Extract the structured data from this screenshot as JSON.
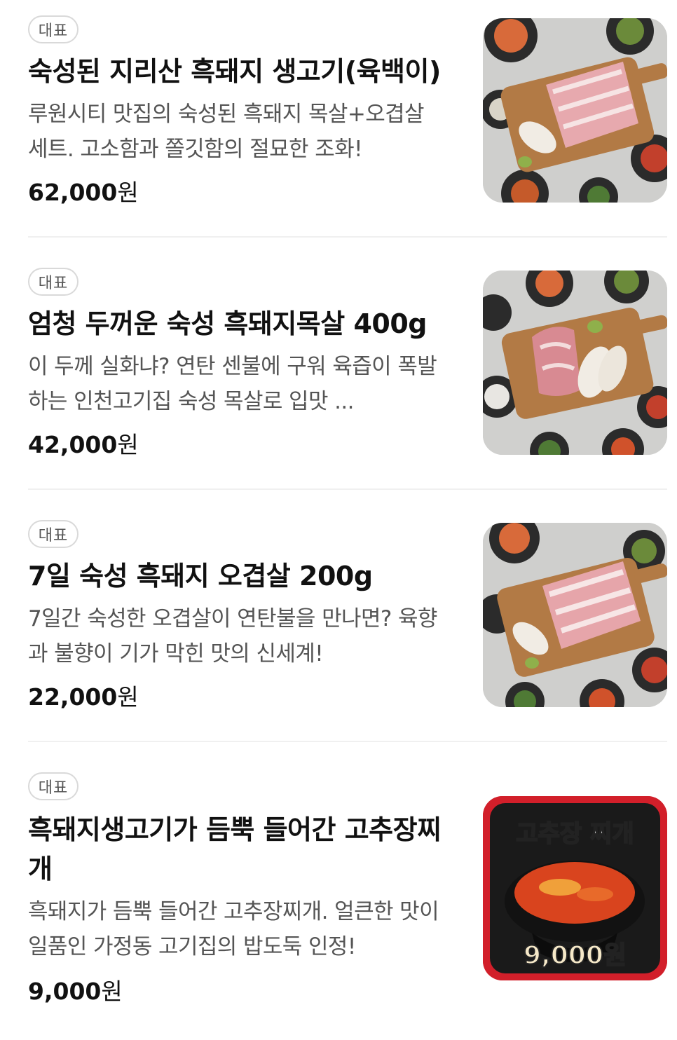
{
  "items": [
    {
      "badge": "대표",
      "title": "숙성된 지리산 흑돼지 생고기(육백이)",
      "description": "루원시티 맛집의 숙성된 흑돼지 목살+오겹살 세트. 고소함과 쫄깃함의 절묘한 조화!",
      "price_number": "62,000",
      "price_unit": "원",
      "image": "pork-platter-photo"
    },
    {
      "badge": "대표",
      "title": "엄청 두꺼운 숙성 흑돼지목살 400g",
      "description": "이 두께 실화냐? 연탄 센불에 구워 육즙이 폭발하는 인천고기집 숙성 목살로 입맛 ...",
      "price_number": "42,000",
      "price_unit": "원",
      "image": "pork-neck-photo"
    },
    {
      "badge": "대표",
      "title": "7일 숙성 흑돼지 오겹살 200g",
      "description": "7일간 숙성한 오겹살이 연탄불을 만나면? 육향과 불향이 기가 막힌 맛의 신세계!",
      "price_number": "22,000",
      "price_unit": "원",
      "image": "pork-belly-photo"
    },
    {
      "badge": "대표",
      "title": "흑돼지생고기가 듬뿍 들어간 고추장찌개",
      "description": "흑돼지가 듬뿍 들어간 고추장찌개. 얼큰한 맛이 일품인 가정동 고기집의 밥도둑 인정!",
      "price_number": "9,000",
      "price_unit": "원",
      "image": "gochujang-jjigae-photo",
      "image_caption_top": "고추장 찌개",
      "image_caption_bottom": "9,000원"
    }
  ]
}
